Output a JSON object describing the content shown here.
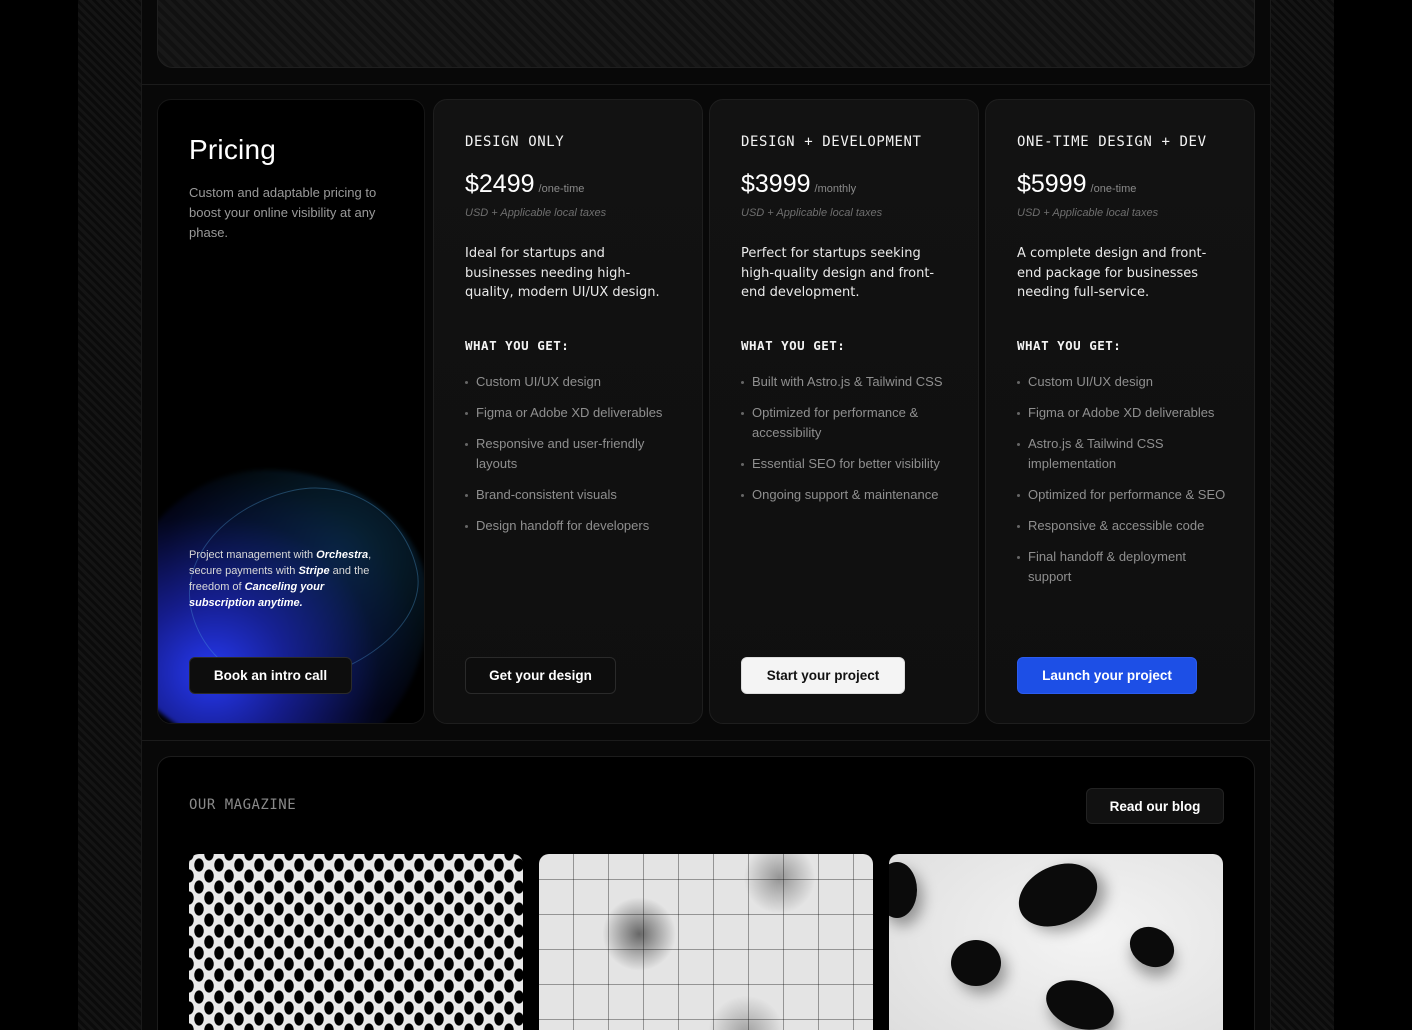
{
  "intro": {
    "title": "Pricing",
    "description": "Custom and adaptable pricing to boost your online visibility at any phase.",
    "note": {
      "part1": "Project management with ",
      "brand1": "Orchestra",
      "part2": ", secure payments with ",
      "brand2": "Stripe",
      "part3": " and the freedom of ",
      "emph": "Canceling your subscription anytime."
    },
    "cta_label": "Book an intro call"
  },
  "plans": [
    {
      "name": "DESIGN ONLY",
      "price": "$2499",
      "period": "/one-time",
      "tax": "USD + Applicable local taxes",
      "description": "Ideal for startups and businesses needing high-quality, modern UI/UX design.",
      "features_label": "WHAT YOU GET:",
      "features": [
        "Custom UI/UX design",
        "Figma or Adobe XD deliverables",
        "Responsive and user-friendly layouts",
        "Brand-consistent visuals",
        "Design handoff for developers"
      ],
      "cta_label": "Get your design"
    },
    {
      "name": "DESIGN + DEVELOPMENT",
      "price": "$3999",
      "period": "/monthly",
      "tax": "USD + Applicable local taxes",
      "description": "Perfect for startups seeking high-quality design and front-end development.",
      "features_label": "WHAT YOU GET:",
      "features": [
        "Built with Astro.js & Tailwind CSS",
        "Optimized for performance & accessibility",
        "Essential SEO for better visibility",
        "Ongoing support & maintenance"
      ],
      "cta_label": "Start your project"
    },
    {
      "name": "ONE-TIME DESIGN + DEV",
      "price": "$5999",
      "period": "/one-time",
      "tax": "USD + Applicable local taxes",
      "description": "A complete design and front-end package for businesses needing full-service.",
      "features_label": "WHAT YOU GET:",
      "features": [
        "Custom UI/UX design",
        "Figma or Adobe XD deliverables",
        "Astro.js & Tailwind CSS implementation",
        "Optimized for performance & SEO",
        "Responsive & accessible code",
        "Final handoff & deployment support"
      ],
      "cta_label": "Launch your project"
    }
  ],
  "magazine": {
    "label": "OUR MAGAZINE",
    "cta_label": "Read our blog"
  },
  "colors": {
    "accent_blue": "#1d4fe6",
    "background": "#000000",
    "card": "#121212"
  }
}
